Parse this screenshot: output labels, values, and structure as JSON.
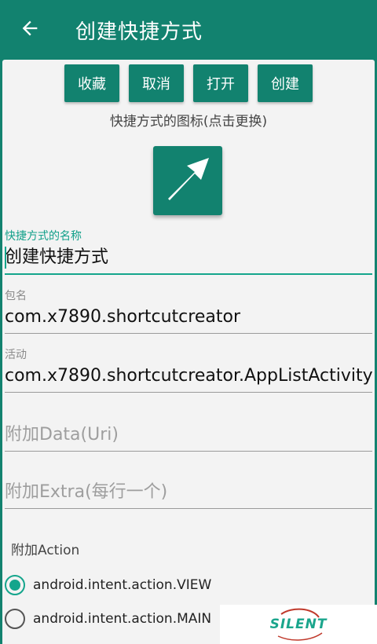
{
  "appbar": {
    "back_icon": "arrow-left-icon",
    "title": "创建快捷方式"
  },
  "actions": {
    "favorite": "收藏",
    "cancel": "取消",
    "open": "打开",
    "create": "创建"
  },
  "icon_section": {
    "caption": "快捷方式的图标(点击更换)",
    "icon": "arrow-up-right-icon"
  },
  "fields": {
    "name": {
      "label": "快捷方式的名称",
      "value": "创建快捷方式"
    },
    "package": {
      "label": "包名",
      "value": "com.x7890.shortcutcreator"
    },
    "activity": {
      "label": "活动",
      "value": "com.x7890.shortcutcreator.AppListActivity"
    },
    "data_uri": {
      "placeholder": "附加Data(Uri)"
    },
    "extra": {
      "placeholder": "附加Extra(每行一个)"
    }
  },
  "action_group": {
    "title": "附加Action",
    "options": [
      {
        "label": "android.intent.action.VIEW",
        "checked": true
      },
      {
        "label": "android.intent.action.MAIN",
        "checked": false
      }
    ]
  },
  "watermark": {
    "text": "SILENT"
  },
  "colors": {
    "primary": "#12826f",
    "accent": "#14a58c",
    "surface": "#f3f3f3"
  }
}
